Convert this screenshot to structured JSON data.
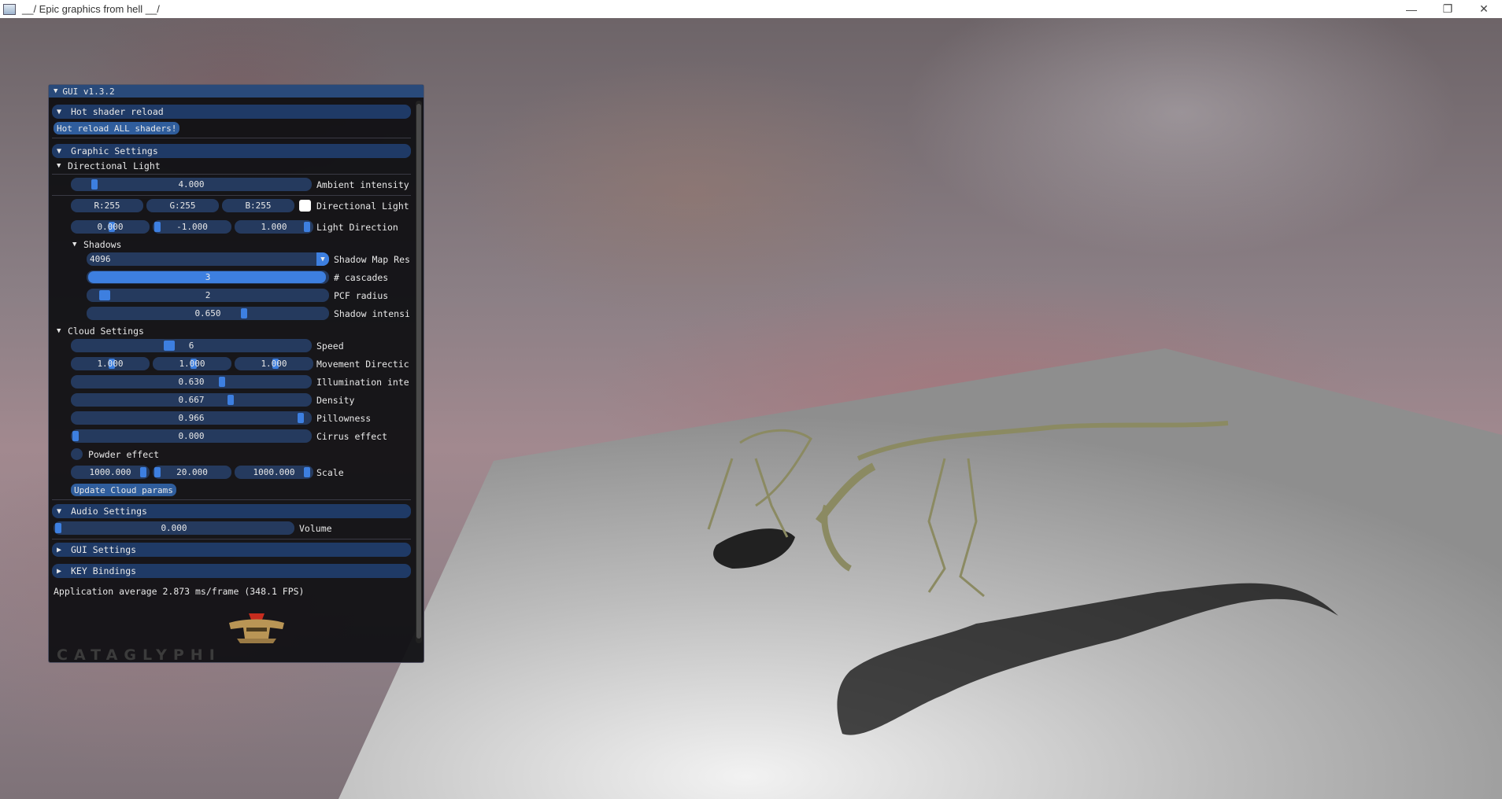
{
  "window": {
    "title": "__/ Epic graphics from hell __/",
    "minimize_glyph": "—",
    "maximize_glyph": "❐",
    "close_glyph": "✕"
  },
  "gui": {
    "title": "GUI v1.3.2",
    "hot_shader_reload": {
      "header": "Hot shader reload",
      "button": "Hot reload ALL shaders!"
    },
    "graphic_settings": {
      "header": "Graphic Settings",
      "directional_light": {
        "label": "Directional Light",
        "ambient_intensity": {
          "value": "4.000",
          "label": "Ambient intensity",
          "fraction": 0.1
        },
        "color": {
          "r": "R:255",
          "g": "G:255",
          "b": "B:255",
          "label": "Directional Light",
          "swatch": "#ffffff"
        },
        "direction": {
          "x": "0.000",
          "y": "-1.000",
          "z": "1.000",
          "label": "Light Direction"
        }
      },
      "shadows": {
        "label": "Shadows",
        "map_res": {
          "value": "4096",
          "label": "Shadow Map Res"
        },
        "cascades": {
          "value": "3",
          "label": "# cascades"
        },
        "pcf_radius": {
          "value": "2",
          "label": "PCF radius"
        },
        "shadow_intensity": {
          "value": "0.650",
          "label": "Shadow intensi"
        }
      },
      "cloud_settings": {
        "label": "Cloud Settings",
        "speed": {
          "value": "6",
          "label": "Speed"
        },
        "movement_direction": {
          "x": "1.000",
          "y": "1.000",
          "z": "1.000",
          "label": "Movement Directic"
        },
        "illumination": {
          "value": "0.630",
          "label": "Illumination inte"
        },
        "density": {
          "value": "0.667",
          "label": "Density"
        },
        "pillowness": {
          "value": "0.966",
          "label": "Pillowness"
        },
        "cirrus": {
          "value": "0.000",
          "label": "Cirrus effect"
        },
        "powder": {
          "label": "Powder effect"
        },
        "scale": {
          "x": "1000.000",
          "y": "20.000",
          "z": "1000.000",
          "label": "Scale"
        },
        "update_button": "Update Cloud params"
      }
    },
    "audio_settings": {
      "header": "Audio Settings",
      "volume": {
        "value": "0.000",
        "label": "Volume"
      }
    },
    "gui_settings": {
      "header": "GUI Settings"
    },
    "key_bindings": {
      "header": "KEY Bindings"
    },
    "stats": "Application average 2.873 ms/frame (348.1 FPS)",
    "logo_text": "CATAGLYPHI"
  },
  "colors": {
    "accent": "#3d7fe0",
    "header": "#1f3a66",
    "frame": "#253a5e",
    "title": "#294a7a"
  }
}
